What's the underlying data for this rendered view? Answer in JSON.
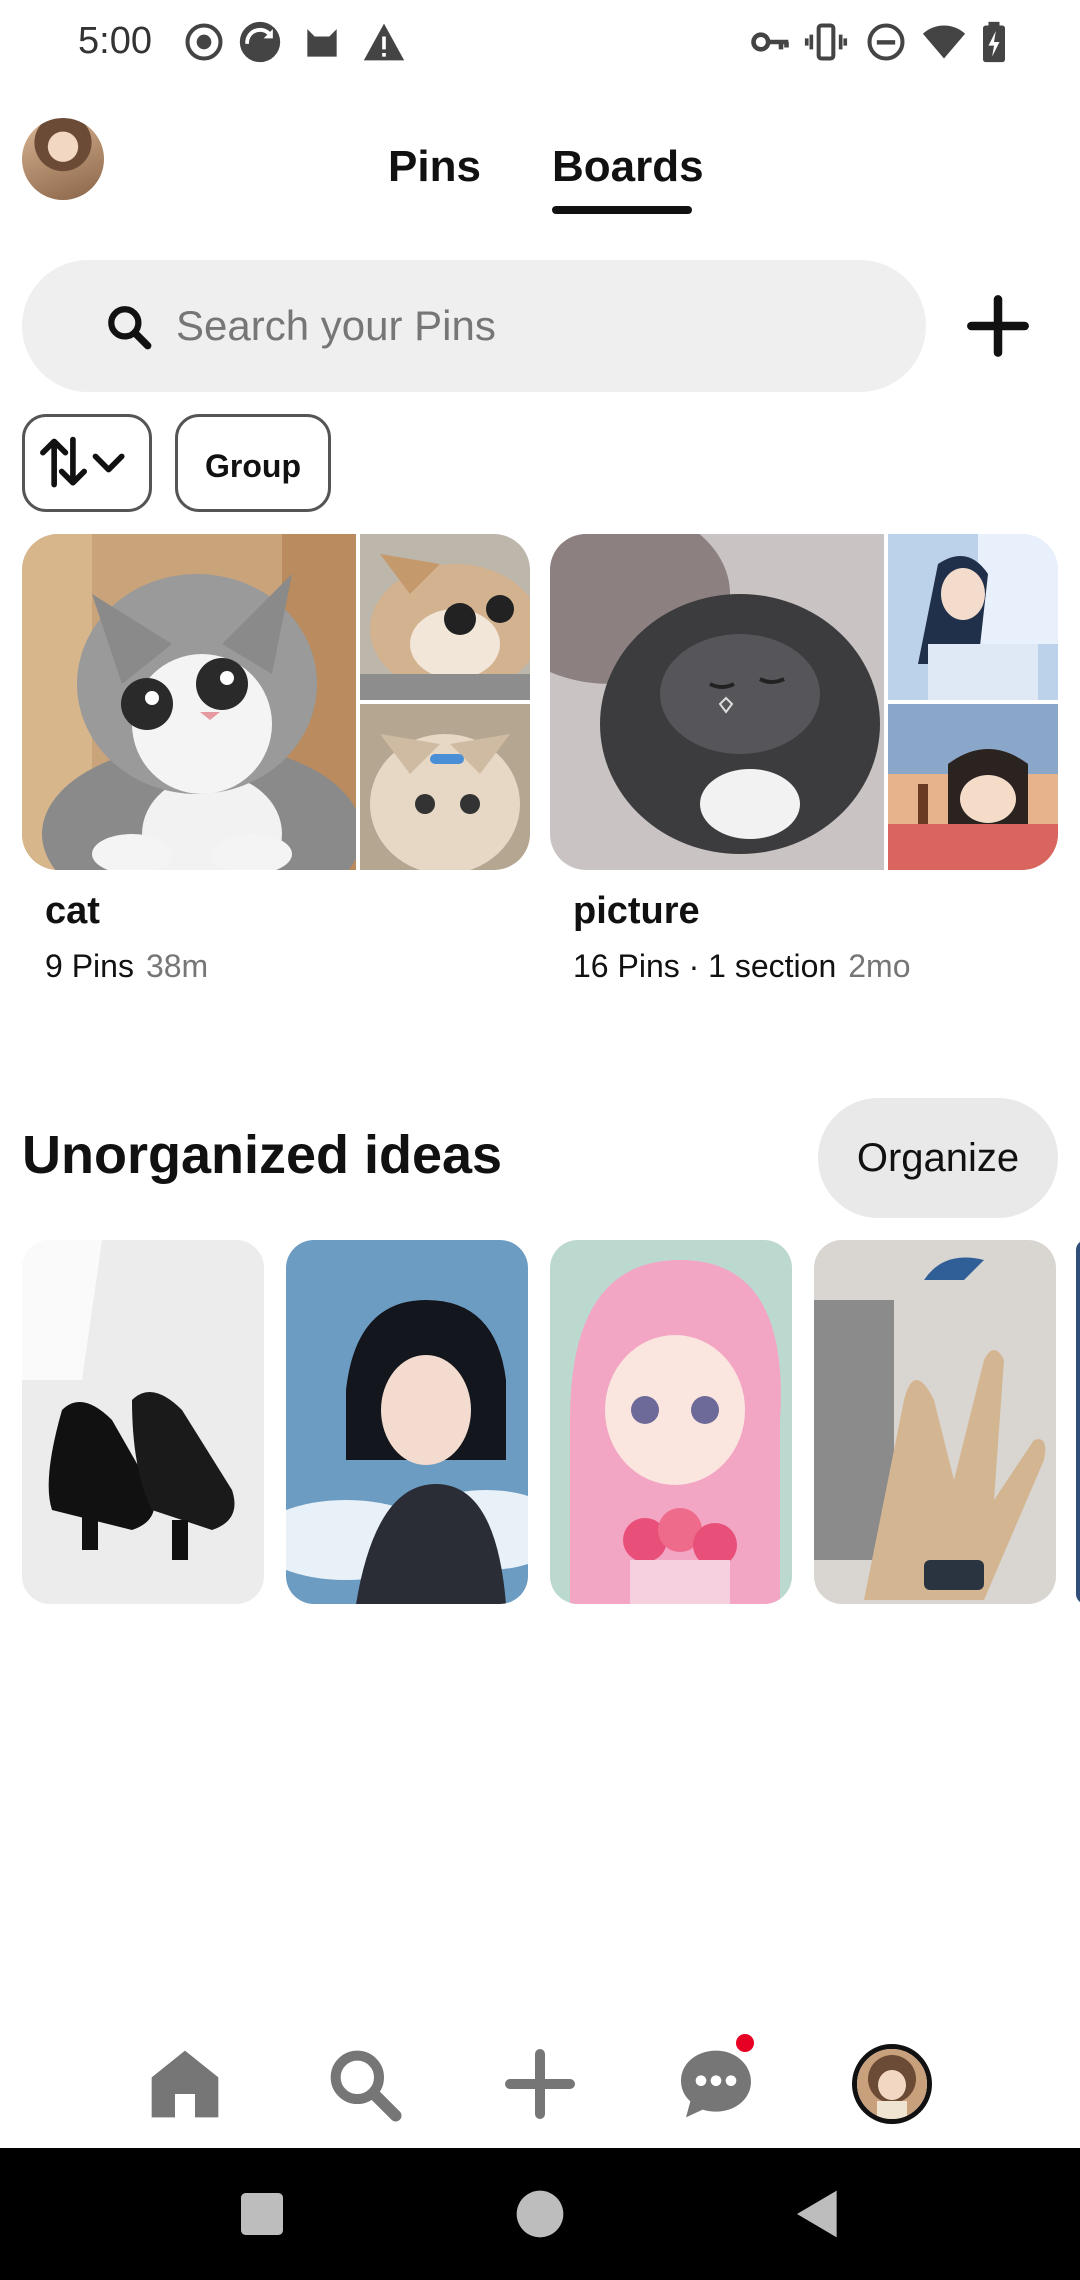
{
  "status_bar": {
    "time": "5:00",
    "left_icons": [
      "record-icon",
      "sync-app-icon",
      "cat-app-icon",
      "warning-icon"
    ],
    "right_icons": [
      "key-icon",
      "vibrate-icon",
      "do-not-disturb-icon",
      "wifi-icon",
      "battery-charging-icon"
    ]
  },
  "header": {
    "tabs": [
      {
        "label": "Pins",
        "selected": false
      },
      {
        "label": "Boards",
        "selected": true
      }
    ]
  },
  "search": {
    "placeholder": "Search your Pins"
  },
  "filters": {
    "sort_icon": "sort-arrows-icon",
    "group_label": "Group"
  },
  "boards": [
    {
      "title": "cat",
      "pins": "9 Pins",
      "time": "38m"
    },
    {
      "title": "picture",
      "pins": "16 Pins · 1 section",
      "time": "2mo"
    }
  ],
  "unorganized": {
    "title": "Unorganized ideas",
    "organize_label": "Organize",
    "ideas": [
      "black-heels-image",
      "short-hair-girl-illustration",
      "pink-hair-girl-illustration",
      "hand-bird-illustration"
    ]
  },
  "bottom_nav": {
    "items": [
      "home-icon",
      "search-icon",
      "create-icon",
      "messages-icon",
      "profile-avatar"
    ],
    "notification_color": "#e60023"
  }
}
